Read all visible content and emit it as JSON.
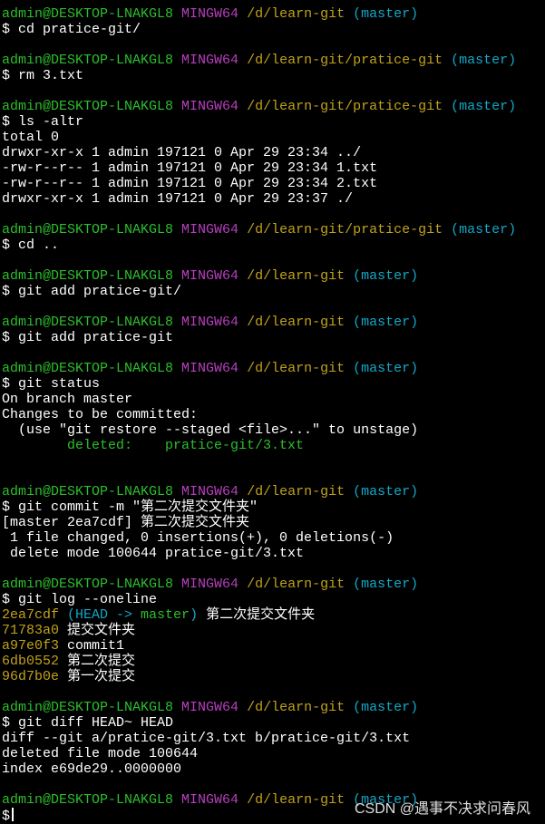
{
  "terminal": {
    "blocks": [
      {
        "path": "/d/learn-git",
        "branch": "(master)",
        "command": "$ cd pratice-git/",
        "output": [],
        "gap_after": true
      },
      {
        "path": "/d/learn-git/pratice-git",
        "branch": "(master)",
        "command": "$ rm 3.txt",
        "output": [],
        "gap_after": true
      },
      {
        "path": "/d/learn-git/pratice-git",
        "branch": "(master)",
        "command": "$ ls -altr",
        "output": [
          {
            "text": "total 0"
          },
          {
            "text": "drwxr-xr-x 1 admin 197121 0 Apr 29 23:34 ../"
          },
          {
            "text": "-rw-r--r-- 1 admin 197121 0 Apr 29 23:34 1.txt"
          },
          {
            "text": "-rw-r--r-- 1 admin 197121 0 Apr 29 23:34 2.txt"
          },
          {
            "text": "drwxr-xr-x 1 admin 197121 0 Apr 29 23:37 ./"
          }
        ],
        "gap_after": true
      },
      {
        "path": "/d/learn-git/pratice-git",
        "branch": "(master)",
        "command": "$ cd ..",
        "output": [],
        "gap_after": true
      },
      {
        "path": "/d/learn-git",
        "branch": "(master)",
        "command": "$ git add pratice-git/",
        "output": [],
        "gap_after": true
      },
      {
        "path": "/d/learn-git",
        "branch": "(master)",
        "command": "$ git add pratice-git",
        "output": [],
        "gap_after": true
      },
      {
        "path": "/d/learn-git",
        "branch": "(master)",
        "command": "$ git status",
        "output": [
          {
            "text": "On branch master"
          },
          {
            "text": "Changes to be committed:"
          },
          {
            "text": "  (use \"git restore --staged <file>...\" to unstage)"
          },
          {
            "text": "        deleted:    pratice-git/3.txt",
            "color": "green"
          },
          {
            "text": ""
          },
          {
            "text": ""
          }
        ],
        "gap_after": false
      },
      {
        "path": "/d/learn-git",
        "branch": "(master)",
        "command": "$ git commit -m \"第二次提交文件夹\"",
        "output": [
          {
            "text": "[master 2ea7cdf] 第二次提交文件夹"
          },
          {
            "text": " 1 file changed, 0 insertions(+), 0 deletions(-)"
          },
          {
            "text": " delete mode 100644 pratice-git/3.txt"
          }
        ],
        "gap_after": true
      },
      {
        "path": "/d/learn-git",
        "branch": "(master)",
        "command": "$ git log --oneline",
        "log": [
          {
            "hash": "2ea7cdf",
            "open": " (",
            "head": "HEAD -> ",
            "ref": "master",
            "close": ")",
            "msg": " 第二次提交文件夹"
          },
          {
            "hash": "71783a0",
            "msg": " 提交文件夹"
          },
          {
            "hash": "a97e0f3",
            "msg": " commit1"
          },
          {
            "hash": "6db0552",
            "msg": " 第二次提交"
          },
          {
            "hash": "96d7b0e",
            "msg": " 第一次提交"
          }
        ],
        "gap_after": true
      },
      {
        "path": "/d/learn-git",
        "branch": "(master)",
        "command": "$ git diff HEAD~ HEAD",
        "output": [
          {
            "text": "diff --git a/pratice-git/3.txt b/pratice-git/3.txt"
          },
          {
            "text": "deleted file mode 100644"
          },
          {
            "text": "index e69de29..0000000"
          }
        ],
        "gap_after": true
      },
      {
        "path": "/d/learn-git",
        "branch": "(master)",
        "command": "$",
        "output": [],
        "gap_after": false,
        "cursor": true
      }
    ],
    "user": "admin@DESKTOP-LNAKGL8",
    "host": "MINGW64"
  },
  "watermark": "CSDN @遇事不决求问春风",
  "colors": {
    "background": "#000000",
    "user": "#2dbe2d",
    "host": "#b83fbf",
    "path": "#c1a21b",
    "branch": "#12a8c6"
  }
}
